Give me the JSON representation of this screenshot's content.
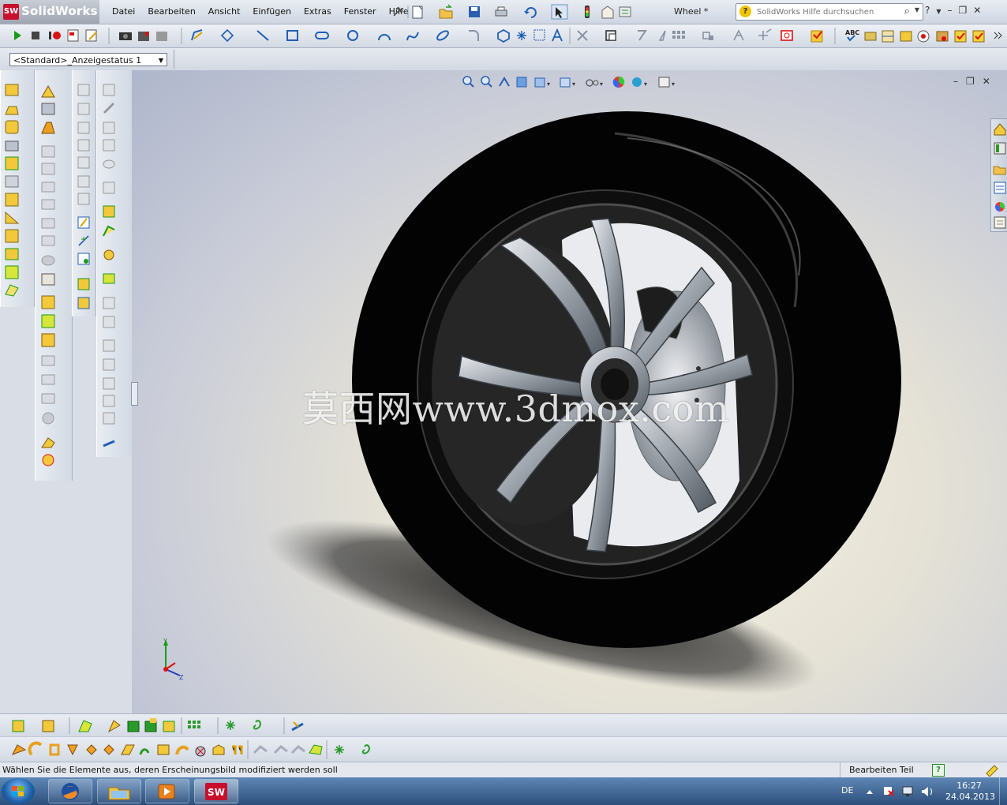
{
  "app": {
    "brand": "SolidWorks",
    "logo_badge": "SW",
    "document_title": "Wheel *"
  },
  "menu": [
    "Datei",
    "Bearbeiten",
    "Ansicht",
    "Einfügen",
    "Extras",
    "Fenster",
    "Hilfe"
  ],
  "search": {
    "placeholder": "SolidWorks Hilfe durchsuchen"
  },
  "config": {
    "selected": "<Standard>_Anzeigestatus 1"
  },
  "watermark": "莫西网www.3dmox.com",
  "triad": {
    "x": "X",
    "y": "Y",
    "z": "Z"
  },
  "status": {
    "message": "Wählen Sie die Elemente aus, deren Erscheinungsbild modifiziert werden soll",
    "mode": "Bearbeiten Teil",
    "help_badge": "?"
  },
  "taskbar": {
    "language": "DE",
    "time": "16:27",
    "date": "24.04.2013",
    "sw_badge": "SW"
  },
  "colors": {
    "accent_red": "#c8102e",
    "toolbar_blue": "#1f5fb5",
    "tire": "#050505",
    "rim": "#c9cdd3"
  }
}
